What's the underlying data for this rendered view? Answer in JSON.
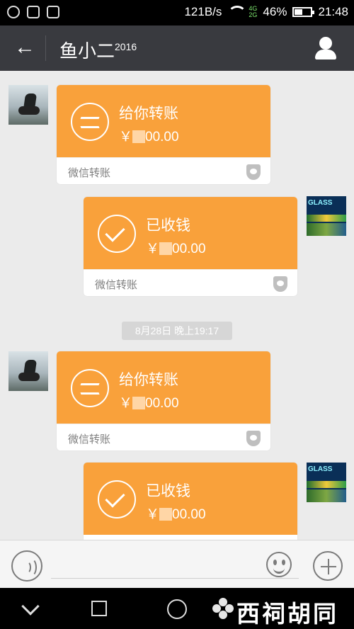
{
  "status_bar": {
    "network_speed": "121B/s",
    "signal_tags": [
      "4G",
      "2G"
    ],
    "battery_percent": "46%",
    "time": "21:48",
    "battery_level": 0.46
  },
  "header": {
    "title": "鱼小二",
    "title_suffix": "2016"
  },
  "messages": [
    {
      "side": "left",
      "title": "给你转账",
      "amount_prefix": "￥",
      "amount_suffix": "00.00",
      "footer": "微信转账",
      "icon": "exchange-icon"
    },
    {
      "side": "right",
      "title": "已收钱",
      "amount_prefix": "￥",
      "amount_suffix": "00.00",
      "footer": "微信转账",
      "icon": "check-icon"
    },
    {
      "timestamp": "8月28日 晚上19:17"
    },
    {
      "side": "left",
      "title": "给你转账",
      "amount_prefix": "￥",
      "amount_suffix": "00.00",
      "footer": "微信转账",
      "icon": "exchange-icon"
    },
    {
      "side": "right",
      "title": "已收钱",
      "amount_prefix": "￥",
      "amount_suffix": "00.00",
      "footer": "",
      "icon": "check-icon"
    }
  ],
  "avatars": {
    "right_logo_text": "GLASS"
  },
  "watermark": "西祠胡同"
}
